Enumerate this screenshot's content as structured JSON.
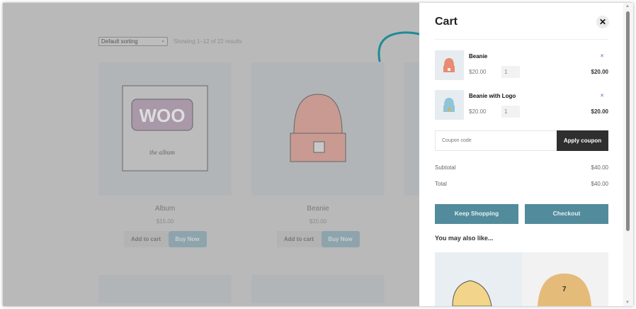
{
  "shop": {
    "sort_label": "Default sorting",
    "result_count": "Showing 1–12 of 22 results",
    "products": [
      {
        "name": "Album",
        "price": "$15.00",
        "add_label": "Add to cart",
        "buy_label": "Buy Now"
      },
      {
        "name": "Beanie",
        "price": "$20.00",
        "add_label": "Add to cart",
        "buy_label": "Buy Now"
      }
    ]
  },
  "cart": {
    "title": "Cart",
    "items": [
      {
        "name": "Beanie",
        "price": "$20.00",
        "qty": "1",
        "total": "$20.00"
      },
      {
        "name": "Beanie with Logo",
        "price": "$20.00",
        "qty": "1",
        "total": "$20.00"
      }
    ],
    "coupon_placeholder": "Coupon code",
    "apply_label": "Apply coupon",
    "subtotal_label": "Subtotal",
    "subtotal": "$40.00",
    "total_label": "Total",
    "total": "$40.00",
    "keep_shopping": "Keep Shopping",
    "checkout": "Checkout",
    "recommend_title": "You may also like..."
  },
  "colors": {
    "accent": "#528c9c",
    "arrow": "#1f8a96"
  }
}
